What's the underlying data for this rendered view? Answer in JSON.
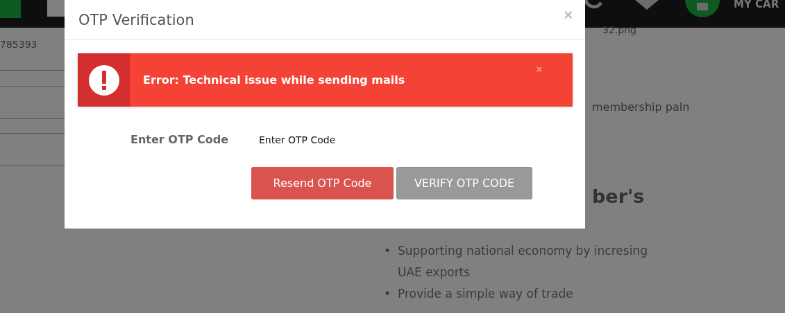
{
  "page": {
    "account_number": "785393",
    "file_name": "32.png",
    "plan_text": "membership paln",
    "heading_fragment": "ber's",
    "cart_label": "MY CAR",
    "bullets": [
      {
        "marker": "•",
        "text": "Supporting national economy by incresing UAE exports"
      },
      {
        "marker": "•",
        "text": "Provide a simple way of trade"
      }
    ]
  },
  "modal": {
    "title": "OTP Verification",
    "close": "×",
    "alert": {
      "message": "Error: Technical issue while sending mails",
      "close": "×"
    },
    "field": {
      "label": "Enter OTP Code",
      "value": "Enter OTP Code"
    },
    "buttons": [
      {
        "label": "Resend OTP Code",
        "kind": "danger"
      },
      {
        "label": "VERIFY OTP CODE",
        "kind": "secondary"
      }
    ]
  }
}
